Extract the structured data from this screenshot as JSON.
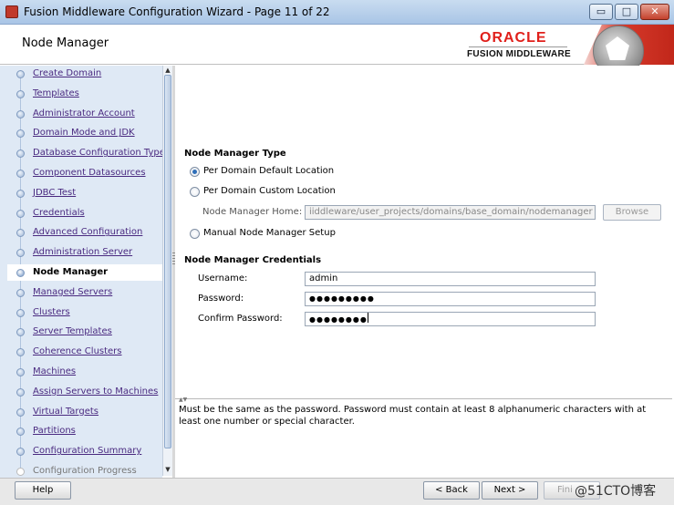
{
  "window": {
    "title": "Fusion Middleware Configuration Wizard - Page 11 of 22",
    "controls": {
      "minimize": "▭",
      "maximize": "□",
      "close": "✕"
    }
  },
  "header": {
    "page_title": "Node Manager",
    "brand": "ORACLE",
    "brand_sub": "FUSION MIDDLEWARE",
    "brand_color": "#e0201b"
  },
  "nav": {
    "items": [
      {
        "label": "Create Domain",
        "state": "done"
      },
      {
        "label": "Templates",
        "state": "done"
      },
      {
        "label": "Administrator Account",
        "state": "done"
      },
      {
        "label": "Domain Mode and JDK",
        "state": "done"
      },
      {
        "label": "Database Configuration Type",
        "state": "done"
      },
      {
        "label": "Component Datasources",
        "state": "done"
      },
      {
        "label": "JDBC Test",
        "state": "done"
      },
      {
        "label": "Credentials",
        "state": "done"
      },
      {
        "label": "Advanced Configuration",
        "state": "done"
      },
      {
        "label": "Administration Server",
        "state": "done"
      },
      {
        "label": "Node Manager",
        "state": "current"
      },
      {
        "label": "Managed Servers",
        "state": "done"
      },
      {
        "label": "Clusters",
        "state": "done"
      },
      {
        "label": "Server Templates",
        "state": "done"
      },
      {
        "label": "Coherence Clusters",
        "state": "done"
      },
      {
        "label": "Machines",
        "state": "done"
      },
      {
        "label": "Assign Servers to Machines",
        "state": "done"
      },
      {
        "label": "Virtual Targets",
        "state": "done"
      },
      {
        "label": "Partitions",
        "state": "done"
      },
      {
        "label": "Configuration Summary",
        "state": "done"
      },
      {
        "label": "Configuration Progress",
        "state": "pending"
      }
    ]
  },
  "main": {
    "type_section": {
      "title": "Node Manager Type",
      "options": [
        {
          "label": "Per Domain Default Location",
          "selected": true
        },
        {
          "label": "Per Domain Custom Location",
          "selected": false
        },
        {
          "label": "Manual Node Manager Setup",
          "selected": false
        }
      ],
      "home_label": "Node Manager Home:",
      "home_value": "iiddleware/user_projects/domains/base_domain/nodemanager",
      "browse_label": "Browse"
    },
    "credentials_section": {
      "title": "Node Manager Credentials",
      "username_label": "Username:",
      "username_value": "admin",
      "password_label": "Password:",
      "password_value": "●●●●●●●●●",
      "confirm_label": "Confirm Password:",
      "confirm_value": "●●●●●●●●"
    }
  },
  "help": {
    "text": "Must be the same as the password. Password must contain at least 8 alphanumeric characters with at least one number or special character."
  },
  "footer": {
    "help_label": "Help",
    "back_label": "< Back",
    "next_label": "Next >",
    "finish_label": "Fini",
    "watermark": "@51CTO博客"
  }
}
